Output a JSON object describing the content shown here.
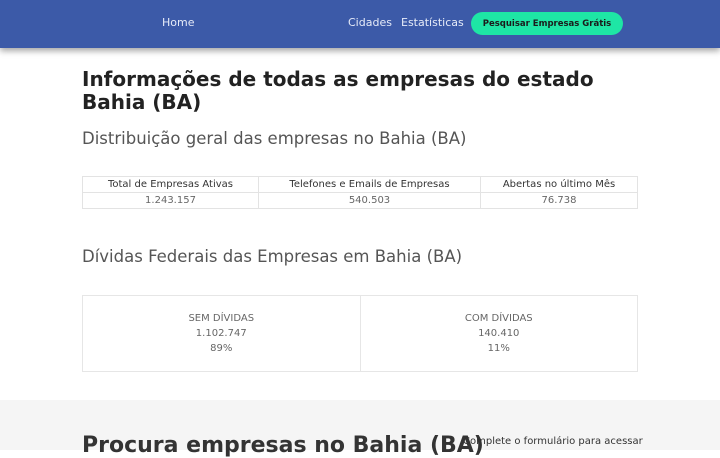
{
  "nav": {
    "home": "Home",
    "cidades": "Cidades",
    "estatisticas": "Estatísticas",
    "cta": "Pesquisar Empresas Grátis"
  },
  "main": {
    "title": "Informações de todas as empresas do estado Bahia (BA)",
    "distribution_heading": "Distribuição geral das empresas no Bahia (BA)",
    "stats_table": {
      "headers": [
        "Total de Empresas Ativas",
        "Telefones e Emails de Empresas",
        "Abertas no último Mês"
      ],
      "values": [
        "1.243.157",
        "540.503",
        "76.738"
      ]
    },
    "debts_heading": "Dívidas Federais das Empresas em Bahia (BA)",
    "debts": {
      "sem": {
        "label": "SEM DÍVIDAS",
        "count": "1.102.747",
        "percent": "89%"
      },
      "com": {
        "label": "COM DÍVIDAS",
        "count": "140.410",
        "percent": "11%"
      }
    }
  },
  "search_section": {
    "heading": "Procura empresas no Bahia (BA)",
    "note": "Complete o formulário para acessar"
  }
}
